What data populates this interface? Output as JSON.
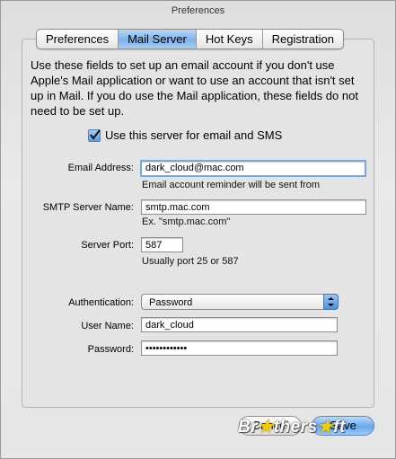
{
  "window": {
    "title": "Preferences"
  },
  "tabs": [
    {
      "label": "Preferences"
    },
    {
      "label": "Mail Server",
      "active": true
    },
    {
      "label": "Hot Keys"
    },
    {
      "label": "Registration"
    }
  ],
  "intro_text": "Use these fields to set up an email account if you don't use Apple's Mail application or want to use an account that isn't set up in Mail.  If you do use the Mail application, these fields do not need to be set up.",
  "use_server": {
    "label": "Use this server for email and SMS",
    "checked": true
  },
  "email": {
    "label": "Email Address:",
    "value": "dark_cloud@mac.com",
    "hint": "Email account reminder will be sent from"
  },
  "smtp": {
    "label": "SMTP Server Name:",
    "value": "smtp.mac.com",
    "hint": "Ex. \"smtp.mac.com\""
  },
  "port": {
    "label": "Server Port:",
    "value": "587",
    "hint": "Usually port 25 or 587"
  },
  "auth": {
    "label": "Authentication:",
    "value": "Password"
  },
  "user": {
    "label": "User Name:",
    "value": "dark_cloud"
  },
  "password": {
    "label": "Password:",
    "value": "••••••••••••"
  },
  "buttons": {
    "cancel": "Cancel",
    "save": "Save"
  },
  "watermark": {
    "text_a": "Br",
    "text_b": "thers",
    "text_c": "ft"
  },
  "colors": {
    "accent": "#7fb0e8",
    "focus_ring": "#7aa7e0"
  }
}
